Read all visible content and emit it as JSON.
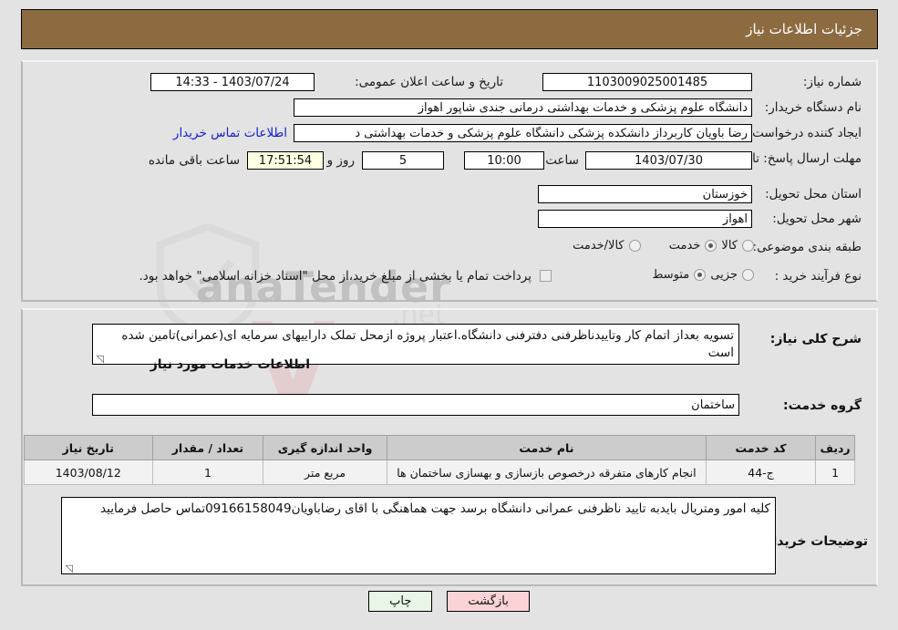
{
  "header": {
    "title": "جزئیات اطلاعات نیاز"
  },
  "form": {
    "need_number_label": "شماره نیاز:",
    "need_number_value": "1103009025001485",
    "announce_datetime_label": "تاریخ و ساعت اعلان عمومی:",
    "announce_datetime_value": "1403/07/24 - 14:33",
    "buyer_org_label": "نام دستگاه خریدار:",
    "buyer_org_value": "دانشگاه علوم پزشکی و خدمات بهداشتی درمانی جندی شاپور اهواز",
    "creator_label": "ایجاد کننده درخواست:",
    "creator_value": "رضا باویان کاربرداز دانشکده پزشکی دانشگاه علوم پزشکی و خدمات بهداشتی د",
    "contact_link": "اطلاعات تماس خریدار",
    "deadline_label": "مهلت ارسال پاسخ: تا تاریخ:",
    "deadline_date": "1403/07/30",
    "deadline_hour_label": "ساعت",
    "deadline_hour": "10:00",
    "remaining_days": "5",
    "remaining_days_label": "روز و",
    "remaining_time": "17:51:54",
    "remaining_time_label": "ساعت باقی مانده",
    "province_label": "استان محل تحویل:",
    "province_value": "خوزستان",
    "city_label": "شهر محل تحویل:",
    "city_value": "اهواز",
    "category_label": "طبقه بندی موضوعی:",
    "category_options": [
      {
        "label": "کالا",
        "selected": false
      },
      {
        "label": "خدمت",
        "selected": true
      },
      {
        "label": "کالا/خدمت",
        "selected": false
      }
    ],
    "process_label": "نوع فرآیند خرید :",
    "process_options": [
      {
        "label": "جزیی",
        "selected": false
      },
      {
        "label": "متوسط",
        "selected": true
      }
    ],
    "treasury_checkbox_text": "پرداخت تمام یا بخشی از مبلغ خرید،از محل \"اسناد خزانه اسلامی\" خواهد بود."
  },
  "description": {
    "label": "شرح کلی نیاز:",
    "value": "تسویه بعداز اتمام کار وتاییدناظرفنی دفترفنی دانشگاه.اعتبار پروژه ازمحل تملک داراییهای سرمایه ای(عمرانی)تامین شده است"
  },
  "services_section": {
    "title": "اطلاعات خدمات مورد نیاز",
    "group_label": "گروه خدمت:",
    "group_value": "ساختمان"
  },
  "table": {
    "columns": [
      "ردیف",
      "کد خدمت",
      "نام خدمت",
      "واحد اندازه گیری",
      "تعداد / مقدار",
      "تاریخ نیاز"
    ],
    "rows": [
      {
        "row_no": "1",
        "service_code": "ج-44",
        "service_name": "انجام کارهای متفرقه درخصوص بازسازی و بهسازی ساختمان ها",
        "unit": "مربع متر",
        "quantity": "1",
        "need_date": "1403/08/12"
      }
    ]
  },
  "buyer_notes": {
    "label": "توضیحات خریدار:",
    "value": "کلیه امور ومتریال بایدبه تایید ناظرفنی عمرانی دانشگاه برسد جهت هماهنگی با اقای رضاباویان09166158049تماس حاصل فرمایید"
  },
  "buttons": {
    "print": "چاپ",
    "back": "بازگشت"
  },
  "watermark": {
    "brand": "anaTender",
    "domain": ".net"
  },
  "colors": {
    "header_bar": "#8d6b40",
    "page_bg": "#e3e3e3",
    "link": "#1320d6",
    "table_header": "#cccccc",
    "btn_print": "#e8f6e8",
    "btn_back": "#fbd3d6",
    "countdown_bg": "#ffffe1"
  }
}
